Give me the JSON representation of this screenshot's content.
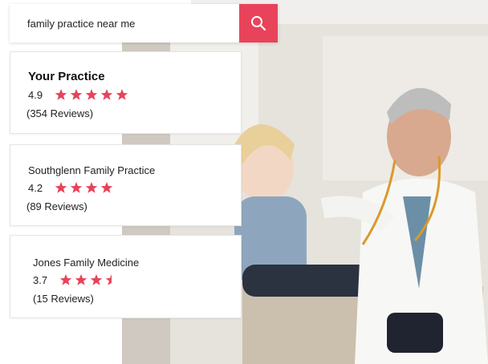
{
  "search": {
    "query": "family practice near me",
    "button_icon": "search-icon"
  },
  "accent_color": "#e8435a",
  "results": [
    {
      "name": "Your Practice",
      "rating": "4.9",
      "stars": 5,
      "reviews": "(354 Reviews)"
    },
    {
      "name": "Southglenn Family Practice",
      "rating": "4.2",
      "stars": 4,
      "reviews": "(89 Reviews)"
    },
    {
      "name": "Jones Family Medicine",
      "rating": "3.7",
      "stars": 3.5,
      "reviews": "(15 Reviews)"
    }
  ],
  "background_image": "doctor-examining-child-photo"
}
